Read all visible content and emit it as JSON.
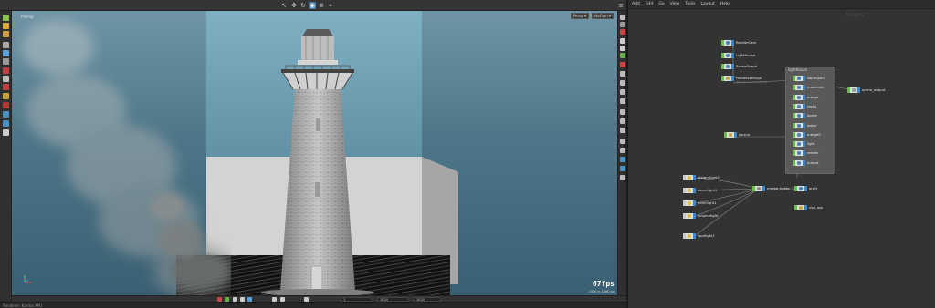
{
  "viewport": {
    "title": "Persp",
    "camera_buttons": [
      "Persp ▾",
      "NoCam ▾"
    ],
    "fps": "67fps",
    "stats": "1000 × 1080 px"
  },
  "playbar": {
    "start_frame": "1",
    "end_frame": "1024",
    "current_frame": "1024"
  },
  "status": {
    "text": "Renderer: Karma XPU"
  },
  "network": {
    "menu": [
      "Add",
      "Edit",
      "Go",
      "View",
      "Tools",
      "Layout",
      "Help"
    ],
    "path": "/stage",
    "title": "Solaris",
    "box_title": "lighthouse",
    "nodes_top": [
      {
        "label": "RenderCam",
        "sub": ""
      },
      {
        "label": "LightHouse",
        "sub": ""
      },
      {
        "label": "SceneGraph",
        "sub": ""
      },
      {
        "label": "rendersettings",
        "sub": "/Render/rendersettings"
      }
    ],
    "box_nodes": [
      "sopimport",
      "materials",
      "merge",
      "rocks",
      "dome",
      "water",
      "merge2",
      "light",
      "render",
      "output"
    ],
    "outside_right": {
      "label": "scene_output",
      "sub": ""
    },
    "mid_node": {
      "label": "karma",
      "sub": ""
    },
    "bottom_nodes": [
      {
        "label": "distantlight1",
        "sub": ""
      },
      {
        "label": "domelight1",
        "sub": ""
      },
      {
        "label": "pointlight1",
        "sub": ""
      },
      {
        "label": "volumelight",
        "sub": ""
      },
      {
        "label": "spotlight1",
        "sub": ""
      }
    ],
    "merge_node": {
      "label": "merge_lights",
      "sub": ""
    },
    "graft_node": {
      "label": "graft",
      "sub": ""
    },
    "usd_node": {
      "label": "usd_rop",
      "sub": ""
    }
  }
}
